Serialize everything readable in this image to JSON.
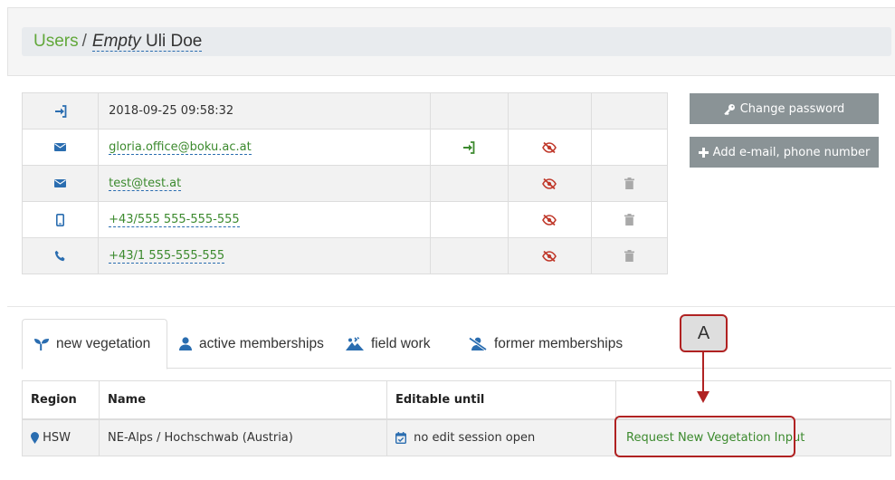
{
  "breadcrumb": {
    "users": "Users",
    "separator": "/",
    "name_italic": "Empty",
    "name_rest": "Uli Doe"
  },
  "contacts": [
    {
      "icon": "sign-in-icon",
      "value": "2018-09-25 09:58:32",
      "link": false,
      "login": false,
      "hidden": false,
      "deletable": false
    },
    {
      "icon": "envelope-icon",
      "value": "gloria.office@boku.ac.at",
      "link": true,
      "login": true,
      "hidden": true,
      "deletable": false
    },
    {
      "icon": "envelope-icon",
      "value": "test@test.at",
      "link": true,
      "login": false,
      "hidden": true,
      "deletable": true
    },
    {
      "icon": "mobile-phone-icon",
      "value": "+43/555 555-555-555",
      "link": true,
      "login": false,
      "hidden": true,
      "deletable": true
    },
    {
      "icon": "phone-icon",
      "value": "+43/1 555-555-555",
      "link": true,
      "login": false,
      "hidden": true,
      "deletable": true
    }
  ],
  "buttons": {
    "change_password": "Change password",
    "add_contact": "Add e-mail, phone number"
  },
  "tabs": [
    {
      "label": "new vegetation",
      "icon": "seedling-icon",
      "active": true
    },
    {
      "label": "active memberships",
      "icon": "user-icon",
      "active": false
    },
    {
      "label": "field work",
      "icon": "field-work-icon",
      "active": false
    },
    {
      "label": "former memberships",
      "icon": "user-slash-icon",
      "active": false
    }
  ],
  "regions_table": {
    "headers": {
      "region": "Region",
      "name": "Name",
      "editable": "Editable until",
      "action": ""
    },
    "rows": [
      {
        "region": "HSW",
        "name": "NE-Alps / Hochschwab (Austria)",
        "editable": "no edit session open",
        "action": "Request New Vegetation Input"
      }
    ]
  },
  "annotation": {
    "label": "A",
    "color": "#b02222"
  },
  "colors": {
    "accent_green": "#3c8a2e",
    "icon_blue": "#2a6db0",
    "hidden_red": "#c0392b",
    "button_grey": "#8a9396"
  }
}
